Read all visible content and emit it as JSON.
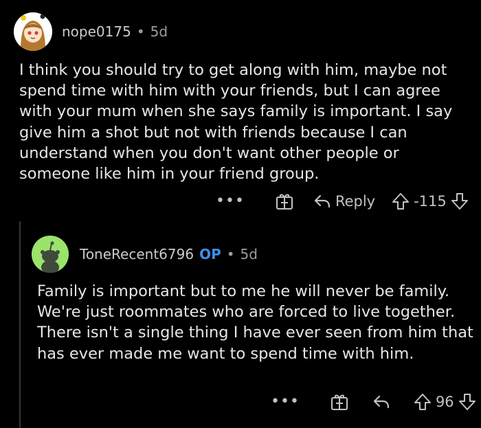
{
  "comments": [
    {
      "username": "nope0175",
      "age": "5d",
      "body": "I think you should try to get along with him, maybe not spend time with him with your friends, but I can agree with your mum when she says family is important. I say give him a shot but not with friends because I can understand when you don't want other people or someone like him in your friend group.",
      "actions": {
        "more": "•••",
        "reply_label": "Reply",
        "score": "-115"
      }
    },
    {
      "username": "ToneRecent6796",
      "op_badge": "OP",
      "age": "5d",
      "body": "Family is important but to me he will never be family. We're just roommates who are forced to live together. There isn't a single thing I have ever seen from him that has ever made me want to spend time with him.",
      "actions": {
        "more": "•••",
        "score": "96"
      }
    }
  ],
  "separator": "•",
  "colors": {
    "background": "#000000",
    "op_badge": "#3b8fea",
    "text": "#e4e6e8",
    "meta": "#9a9c9e"
  }
}
